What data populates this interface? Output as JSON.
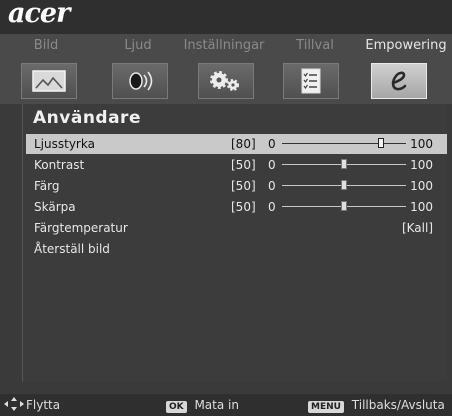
{
  "brand": {
    "logo": "acer"
  },
  "tabs": [
    {
      "label": "Bild",
      "icon": "picture-icon"
    },
    {
      "label": "Ljud",
      "icon": "speaker-icon"
    },
    {
      "label": "Inställningar",
      "icon": "gears-icon"
    },
    {
      "label": "Tillval",
      "icon": "checklist-icon"
    },
    {
      "label": "Empowering",
      "icon": "empowering-e-icon"
    }
  ],
  "active_tab": "Empowering",
  "panel": {
    "title": "Användare",
    "items": [
      {
        "label": "Ljusstyrka",
        "value": "[80]",
        "min": "0",
        "max": "100",
        "level": 80,
        "selected": true
      },
      {
        "label": "Kontrast",
        "value": "[50]",
        "min": "0",
        "max": "100",
        "level": 50
      },
      {
        "label": "Färg",
        "value": "[50]",
        "min": "0",
        "max": "100",
        "level": 50
      },
      {
        "label": "Skärpa",
        "value": "[50]",
        "min": "0",
        "max": "100",
        "level": 50
      },
      {
        "label": "Färgtemperatur",
        "setting": "[Kall]"
      },
      {
        "label": "Återställ bild"
      }
    ]
  },
  "footer": {
    "move_label": "Flytta",
    "ok_key": "OK",
    "ok_label": "Mata in",
    "menu_key": "MENU",
    "menu_label": "Tillbaks/Avsluta"
  },
  "colors": {
    "background": "#3a3a3a",
    "highlight": "#c9c9c9",
    "text": "#e8e8e8"
  }
}
